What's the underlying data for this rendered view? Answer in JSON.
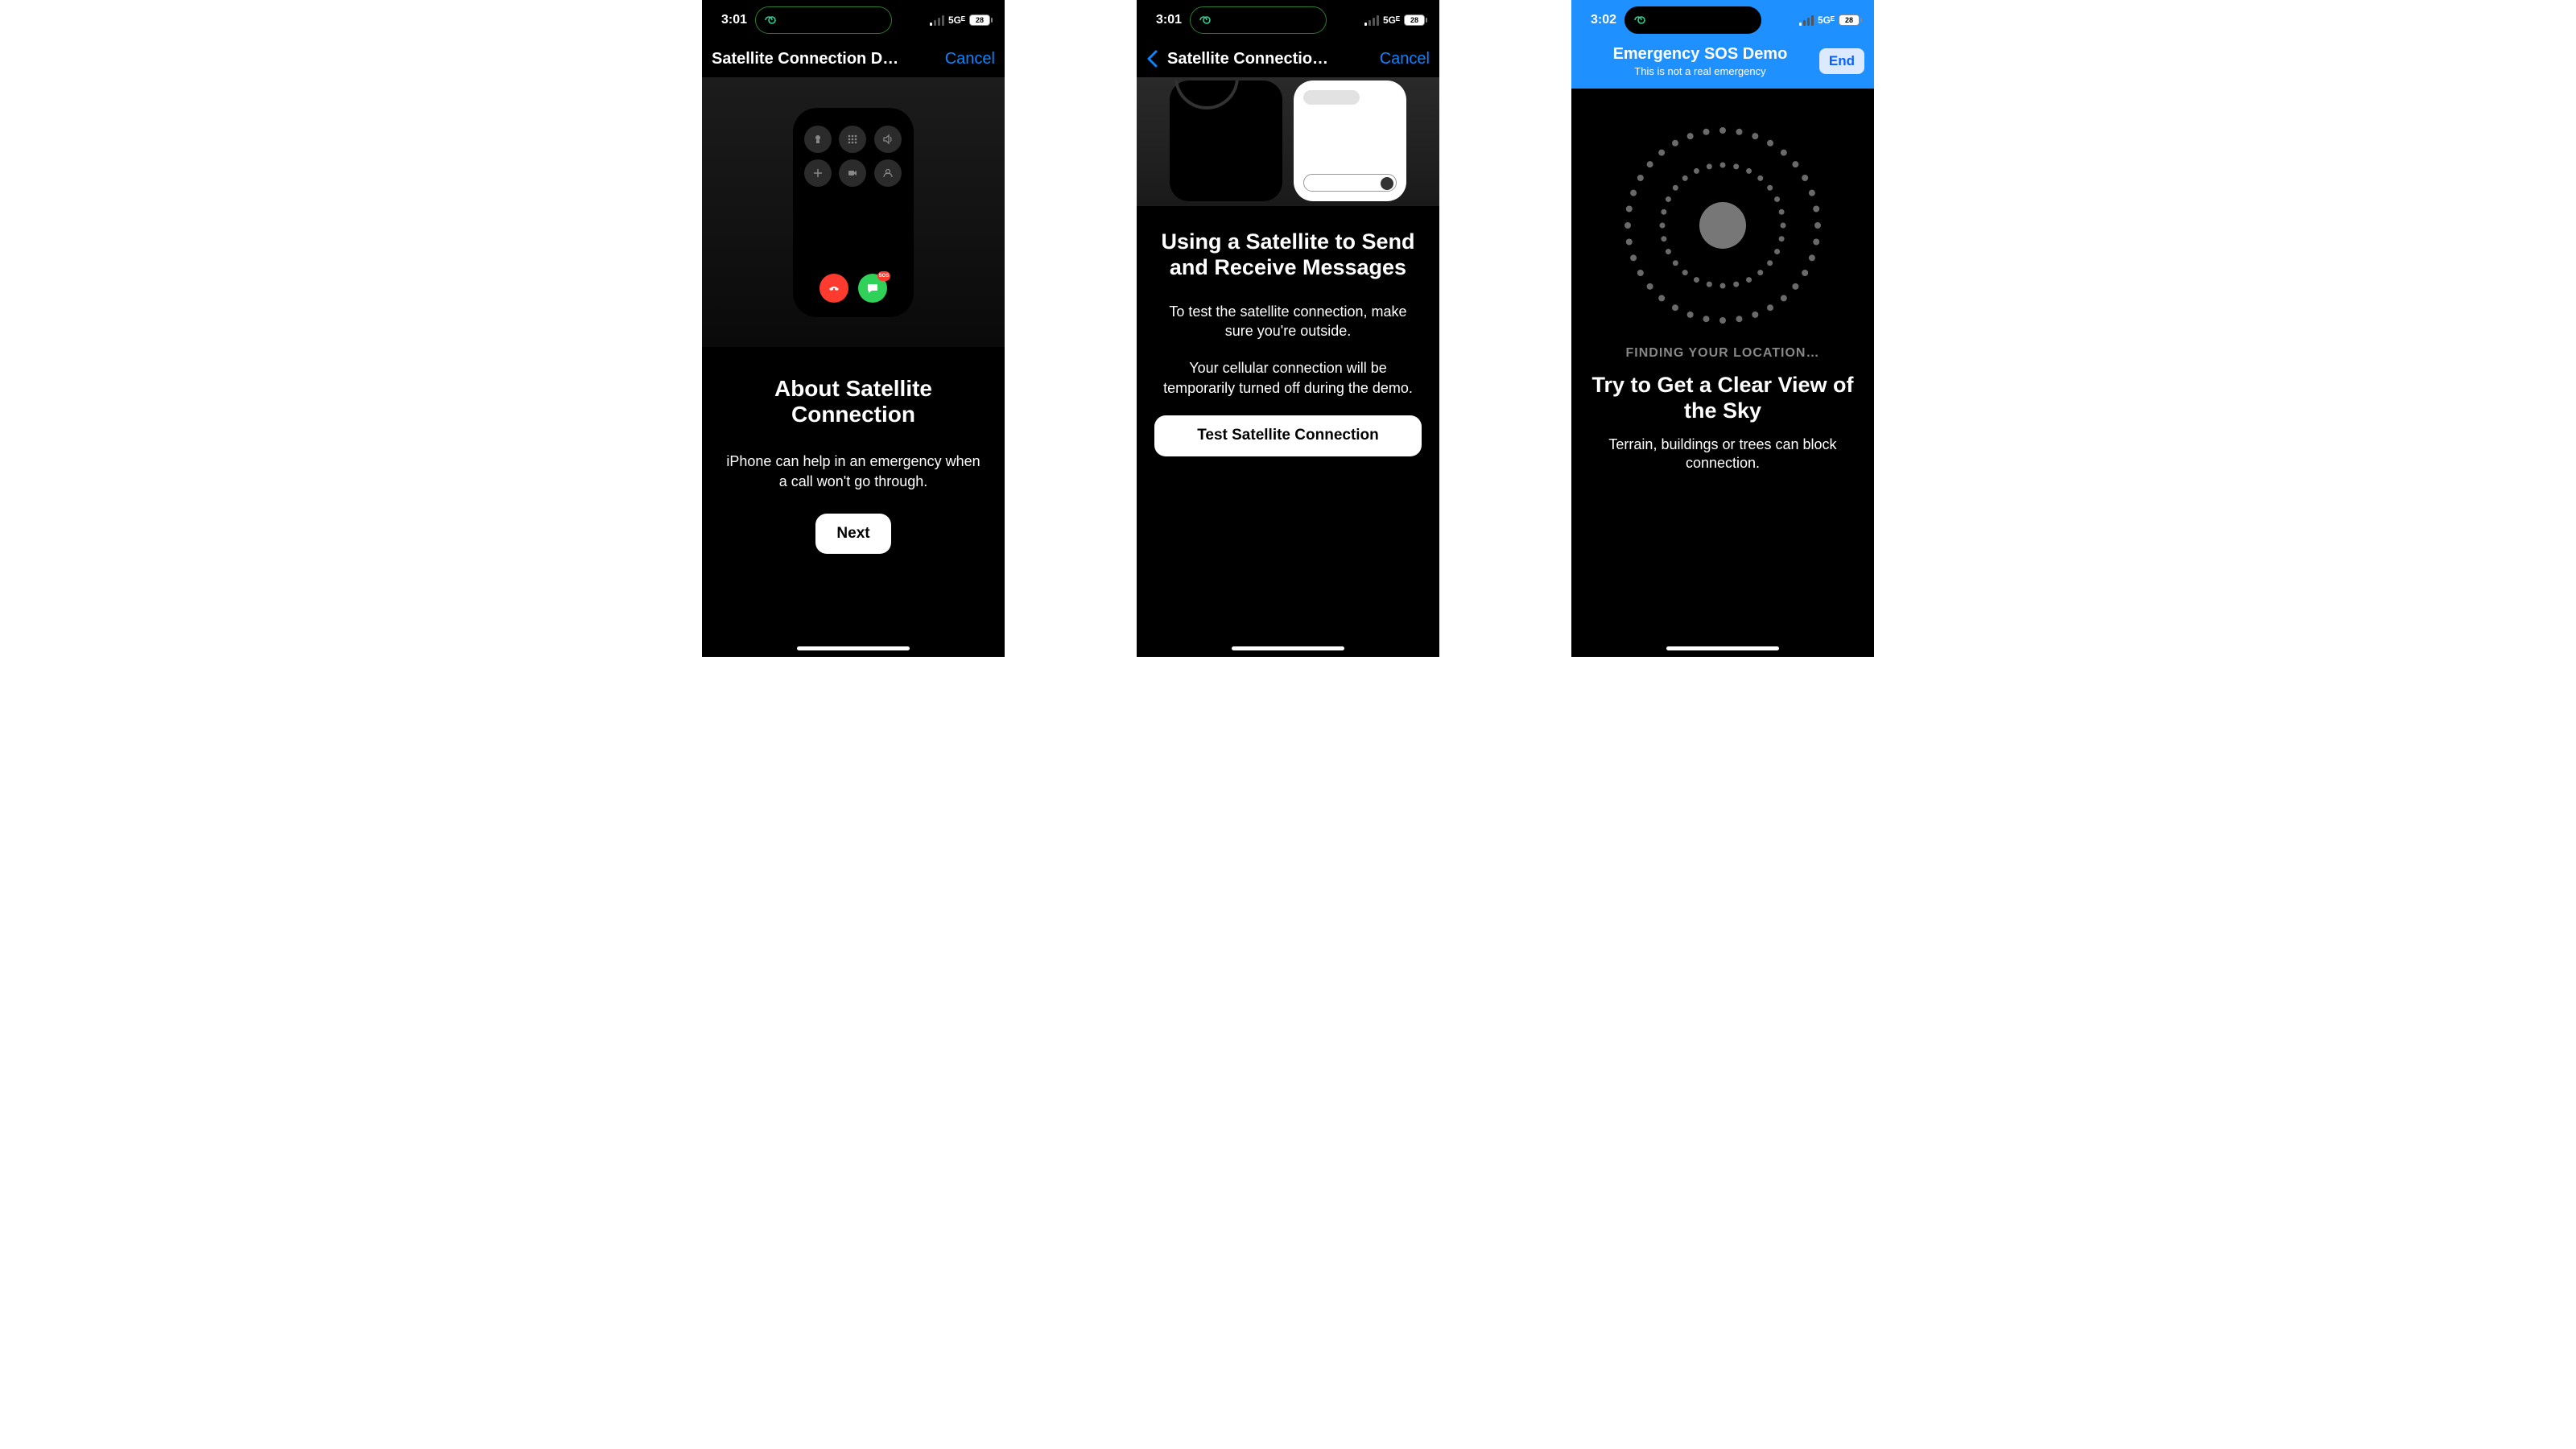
{
  "status": {
    "time_a": "3:01",
    "time_b": "3:01",
    "time_c": "3:02",
    "network": "5Gᴱ",
    "battery": "28"
  },
  "screen1": {
    "nav_title": "Satellite Connection D…",
    "cancel": "Cancel",
    "heading": "About Satellite Connection",
    "body": "iPhone can help in an emergency when a call won't go through.",
    "next": "Next",
    "sos_badge": "SOS"
  },
  "screen2": {
    "nav_title": "Satellite Connectio…",
    "cancel": "Cancel",
    "heading": "Using a Satellite to Send and Receive Messages",
    "body1": "To test the satellite connection, make sure you're outside.",
    "body2": "Your cellular connection will be temporarily turned off during the demo.",
    "button": "Test Satellite Connection"
  },
  "screen3": {
    "nav_title": "Emergency SOS Demo",
    "nav_sub": "This is not a real emergency",
    "end": "End",
    "finding": "FINDING YOUR LOCATION…",
    "heading": "Try to Get a Clear View of the Sky",
    "body": "Terrain, buildings or trees can block connection."
  }
}
